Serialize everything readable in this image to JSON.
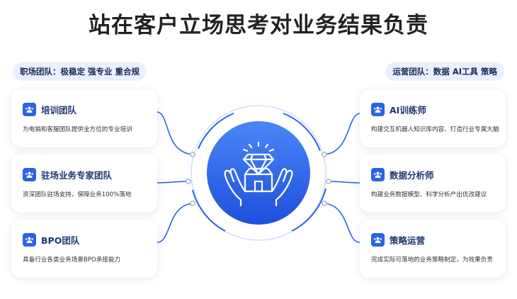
{
  "title": "站在客户立场思考对业务结果负责",
  "left": {
    "label": "职场团队：极稳定  强专业  重合规",
    "cards": [
      {
        "name": "培训团队",
        "desc": "为电销和客服团队提供全方位的专业培训"
      },
      {
        "name": "驻场业务专家团队",
        "desc": "资深团队驻场支持，保障业务100%落地"
      },
      {
        "name": "BPO团队",
        "desc": "具备行业各类业务场景BPO承接能力"
      }
    ]
  },
  "right": {
    "label": "运营团队：数据  AI工具  策略",
    "cards": [
      {
        "name": "AI训练师",
        "desc": "构建交互机器人知识库内容、打造行业专属大脑"
      },
      {
        "name": "数据分析师",
        "desc": "构建业务数据模型、科学分析产出优改建议"
      },
      {
        "name": "策略运营",
        "desc": "完成实际可落地的业务策略制定，为效果负责"
      }
    ]
  },
  "colors": {
    "accent": "#2b63e8",
    "accent_light": "#5b8cf5",
    "pill_bg": "#eaf0fd"
  },
  "icons": {
    "card": "team-icon",
    "center": "diamond-in-hands-icon"
  }
}
